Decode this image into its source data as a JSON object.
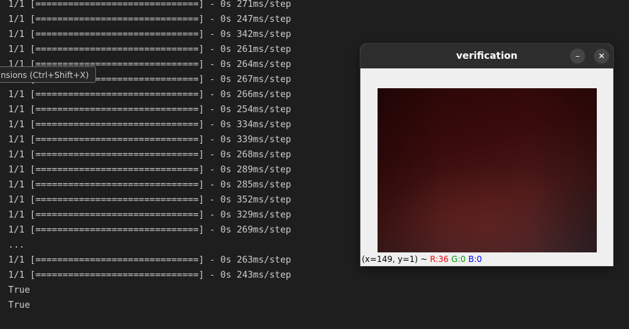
{
  "terminal": {
    "lines": [
      "1/1 [==============================] - 0s 271ms/step",
      "1/1 [==============================] - 0s 247ms/step",
      "1/1 [==============================] - 0s 342ms/step",
      "1/1 [==============================] - 0s 261ms/step",
      "1/1 [==============================] - 0s 264ms/step",
      "1/1 [==============================] - 0s 267ms/step",
      "1/1 [==============================] - 0s 266ms/step",
      "1/1 [==============================] - 0s 254ms/step",
      "1/1 [==============================] - 0s 334ms/step",
      "1/1 [==============================] - 0s 339ms/step",
      "1/1 [==============================] - 0s 268ms/step",
      "1/1 [==============================] - 0s 289ms/step",
      "1/1 [==============================] - 0s 285ms/step",
      "1/1 [==============================] - 0s 352ms/step",
      "1/1 [==============================] - 0s 329ms/step",
      "1/1 [==============================] - 0s 269ms/step",
      "...",
      "1/1 [==============================] - 0s 263ms/step",
      "1/1 [==============================] - 0s 243ms/step",
      "True",
      "True"
    ],
    "tooltip": "nsions (Ctrl+Shift+X)"
  },
  "window": {
    "title": "verification",
    "minimize_glyph": "–",
    "close_glyph": "✕",
    "status": {
      "coords": "(x=149, y=1) ~ ",
      "r": "R:36",
      "g": "G:0",
      "b": "B:0"
    }
  },
  "colors": {
    "terminal_bg": "#1e1e1e",
    "terminal_text": "#cccccc",
    "titlebar_bg": "#2d2d2d",
    "window_bg": "#efefef",
    "status_r": "#ee0000",
    "status_g": "#009900",
    "status_b": "#0000ee"
  },
  "icons": {
    "minimize": "minimize-icon",
    "close": "close-icon"
  }
}
